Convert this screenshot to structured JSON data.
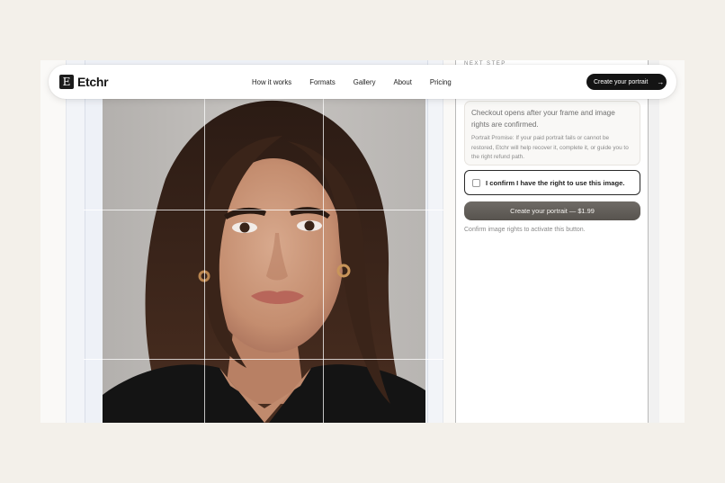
{
  "brand": {
    "logo_letter": "E",
    "name": "Etchr"
  },
  "nav": {
    "links": [
      "How it works",
      "Formats",
      "Gallery",
      "About",
      "Pricing"
    ],
    "cta_label": "Create your portrait",
    "cta_icon": "arrow-right-icon"
  },
  "panel": {
    "section_label": "NEXT STEP",
    "info_main": "Checkout opens after your frame and image rights are confirmed.",
    "info_promise": "Portrait Promise: If your paid portrait fails or cannot be restored, Etchr will help recover it, complete it, or guide you to the right refund path.",
    "confirm_label": "I confirm I have the right to use this image.",
    "confirm_checked": false,
    "create_button": "Create your portrait — $1.99",
    "hint": "Confirm image rights to activate this button."
  },
  "colors": {
    "background": "#f3f0ea",
    "nav_cta": "#141414",
    "create_button": "#5f5b56"
  }
}
